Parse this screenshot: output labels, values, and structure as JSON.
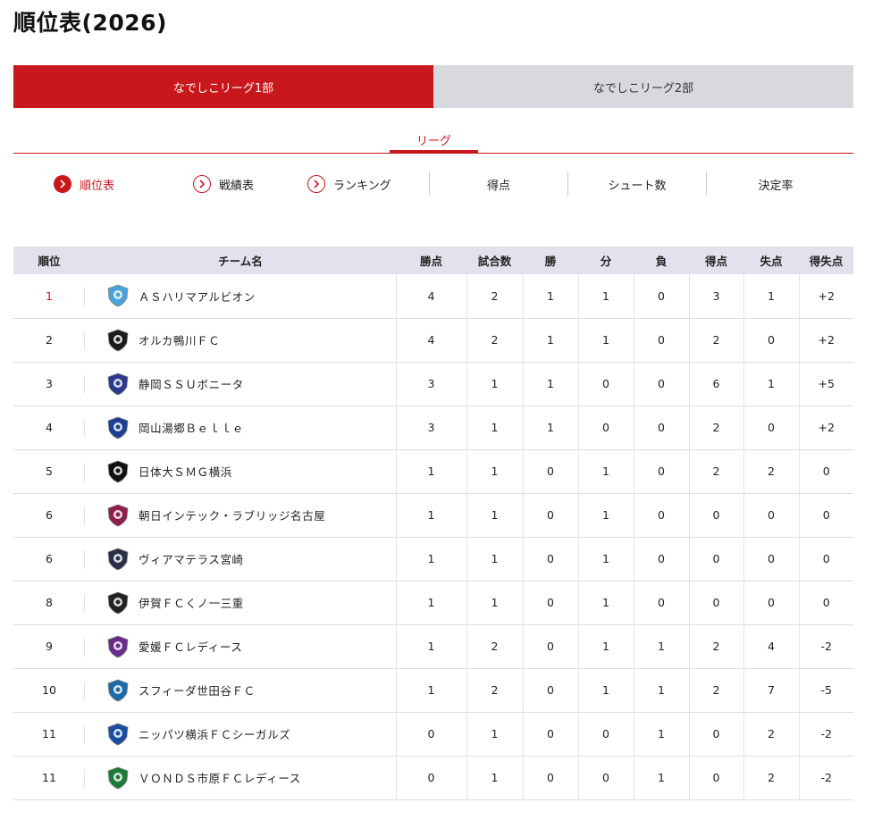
{
  "page": {
    "title": "順位表(2026)"
  },
  "division_tabs": [
    {
      "label": "なでしこリーグ1部",
      "active": true
    },
    {
      "label": "なでしこリーグ2部",
      "active": false
    }
  ],
  "sub_tab": {
    "label": "リーグ"
  },
  "stat_nav": {
    "standings": "順位表",
    "results": "戦績表",
    "ranking": "ランキング",
    "goals": "得点",
    "shots": "シュート数",
    "conversion": "決定率"
  },
  "table": {
    "headers": {
      "rank": "順位",
      "team": "チーム名",
      "points": "勝点",
      "played": "試合数",
      "won": "勝",
      "drawn": "分",
      "lost": "負",
      "gf": "得点",
      "ga": "失点",
      "gd": "得失点"
    },
    "rows": [
      {
        "rank": "1",
        "team": "ＡＳハリマアルビオン",
        "points": "4",
        "played": "2",
        "won": "1",
        "drawn": "1",
        "lost": "0",
        "gf": "3",
        "ga": "1",
        "gd": "+2",
        "logo": "albion-logo",
        "color": "#4aa3d8"
      },
      {
        "rank": "2",
        "team": "オルカ鴨川ＦＣ",
        "points": "4",
        "played": "2",
        "won": "1",
        "drawn": "1",
        "lost": "0",
        "gf": "2",
        "ga": "0",
        "gd": "+2",
        "logo": "orca-logo",
        "color": "#1b1b1b"
      },
      {
        "rank": "3",
        "team": "静岡ＳＳＵボニータ",
        "points": "3",
        "played": "1",
        "won": "1",
        "drawn": "0",
        "lost": "0",
        "gf": "6",
        "ga": "1",
        "gd": "+5",
        "logo": "bonita-logo",
        "color": "#2b3a8c"
      },
      {
        "rank": "4",
        "team": "岡山湯郷Ｂｅｌｌｅ",
        "points": "3",
        "played": "1",
        "won": "1",
        "drawn": "0",
        "lost": "0",
        "gf": "2",
        "ga": "0",
        "gd": "+2",
        "logo": "belle-logo",
        "color": "#1d3f8f"
      },
      {
        "rank": "5",
        "team": "日体大ＳＭＧ横浜",
        "points": "1",
        "played": "1",
        "won": "0",
        "drawn": "1",
        "lost": "0",
        "gf": "2",
        "ga": "2",
        "gd": "0",
        "logo": "smg-logo",
        "color": "#111111"
      },
      {
        "rank": "6",
        "team": "朝日インテック・ラブリッジ名古屋",
        "points": "1",
        "played": "1",
        "won": "0",
        "drawn": "1",
        "lost": "0",
        "gf": "0",
        "ga": "0",
        "gd": "0",
        "logo": "loveledge-logo",
        "color": "#8e1e4a"
      },
      {
        "rank": "6",
        "team": "ヴィアマテラス宮崎",
        "points": "1",
        "played": "1",
        "won": "0",
        "drawn": "1",
        "lost": "0",
        "gf": "0",
        "ga": "0",
        "gd": "0",
        "logo": "viamateras-logo",
        "color": "#2a2f4a"
      },
      {
        "rank": "8",
        "team": "伊賀ＦＣくノ一三重",
        "points": "1",
        "played": "1",
        "won": "0",
        "drawn": "1",
        "lost": "0",
        "gf": "0",
        "ga": "0",
        "gd": "0",
        "logo": "iga-logo",
        "color": "#222222"
      },
      {
        "rank": "9",
        "team": "愛媛ＦＣレディース",
        "points": "1",
        "played": "2",
        "won": "0",
        "drawn": "1",
        "lost": "1",
        "gf": "2",
        "ga": "4",
        "gd": "-2",
        "logo": "ehime-logo",
        "color": "#6a2c8a"
      },
      {
        "rank": "10",
        "team": "スフィーダ世田谷ＦＣ",
        "points": "1",
        "played": "2",
        "won": "0",
        "drawn": "1",
        "lost": "1",
        "gf": "2",
        "ga": "7",
        "gd": "-5",
        "logo": "sfida-logo",
        "color": "#1d6aa8"
      },
      {
        "rank": "11",
        "team": "ニッパツ横浜ＦＣシーガルズ",
        "points": "0",
        "played": "1",
        "won": "0",
        "drawn": "0",
        "lost": "1",
        "gf": "0",
        "ga": "2",
        "gd": "-2",
        "logo": "seagulls-logo",
        "color": "#1a4fa0"
      },
      {
        "rank": "11",
        "team": "ＶＯＮＤＳ市原ＦＣレディース",
        "points": "0",
        "played": "1",
        "won": "0",
        "drawn": "0",
        "lost": "1",
        "gf": "0",
        "ga": "2",
        "gd": "-2",
        "logo": "vonds-logo",
        "color": "#1d7a3a"
      }
    ]
  },
  "colors": {
    "accent": "#c8181c",
    "tab_inactive": "#d8d8df",
    "header_bg": "#e2e2ee"
  }
}
